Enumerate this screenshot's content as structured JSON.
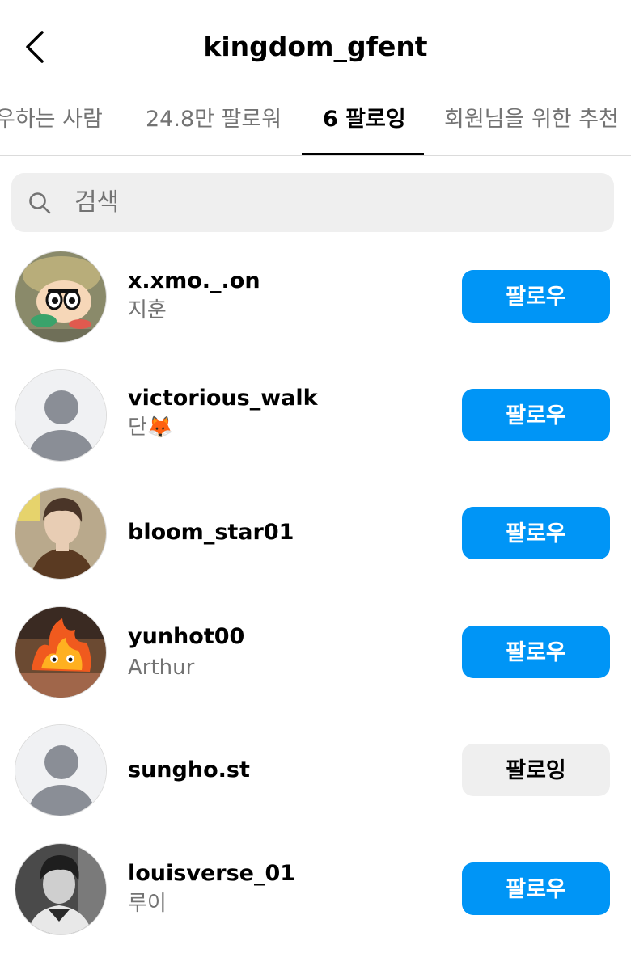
{
  "header": {
    "title": "kingdom_gfent"
  },
  "tabs": [
    {
      "label": "우하는 사람",
      "active": false
    },
    {
      "label": "24.8만 팔로워",
      "active": false
    },
    {
      "label": "6 팔로잉",
      "active": true
    },
    {
      "label": "회원님을 위한 추천",
      "active": false
    }
  ],
  "search": {
    "placeholder": "검색"
  },
  "users": [
    {
      "username": "x.xmo._.on",
      "fullname": "지훈",
      "button": "팔로우",
      "button_state": "follow",
      "avatar": "cartoon-boy-avatar"
    },
    {
      "username": "victorious_walk",
      "fullname": "단🦊",
      "button": "팔로우",
      "button_state": "follow",
      "avatar": "default-avatar"
    },
    {
      "username": "bloom_star01",
      "fullname": "",
      "button": "팔로우",
      "button_state": "follow",
      "avatar": "person-photo-avatar"
    },
    {
      "username": "yunhot00",
      "fullname": "Arthur",
      "button": "팔로우",
      "button_state": "follow",
      "avatar": "fire-character-avatar"
    },
    {
      "username": "sungho.st",
      "fullname": "",
      "button": "팔로잉",
      "button_state": "following",
      "avatar": "default-avatar"
    },
    {
      "username": "louisverse_01",
      "fullname": "루이",
      "button": "팔로우",
      "button_state": "follow",
      "avatar": "bw-photo-avatar"
    }
  ],
  "colors": {
    "accent": "#0095f6",
    "secondary_button": "#efefef",
    "muted_text": "#737373"
  }
}
